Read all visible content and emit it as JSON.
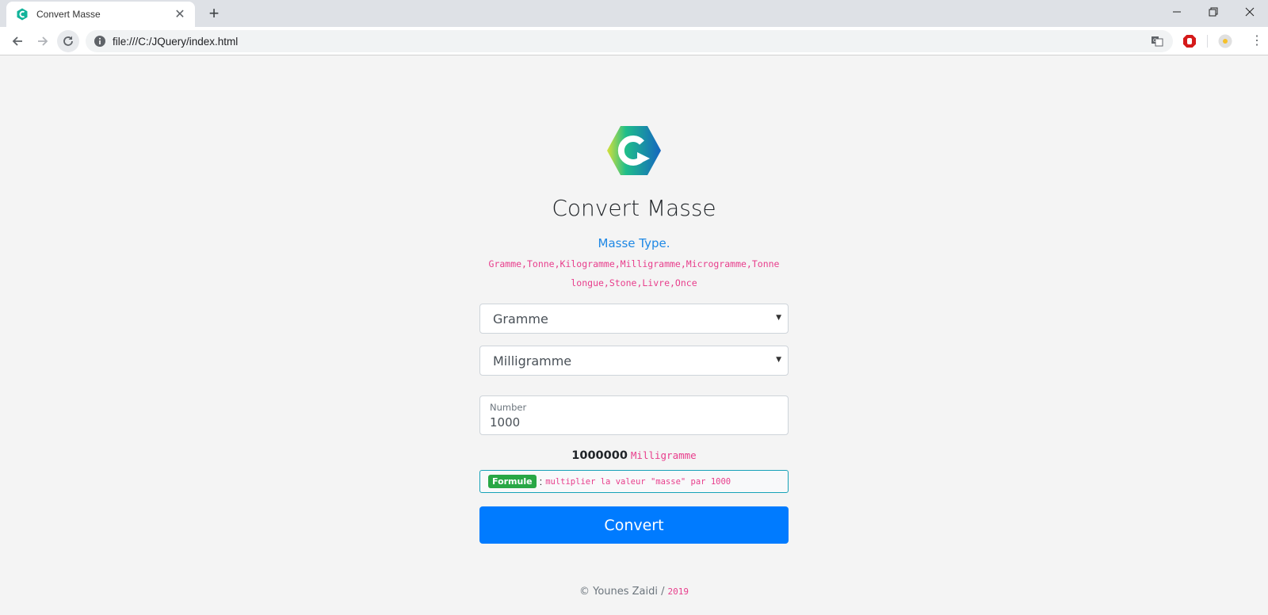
{
  "browser": {
    "tab_title": "Convert Masse",
    "new_tab_symbol": "+",
    "address": "file:///C:/JQuery/index.html"
  },
  "page": {
    "title": "Convert Masse",
    "types_heading": "Masse Type.",
    "types_list": "Gramme,Tonne,Kilogramme,Milligramme,Microgramme,Tonne longue,Stone,Livre,Once",
    "from_unit": {
      "selected": "Gramme"
    },
    "to_unit": {
      "selected": "Milligramme"
    },
    "number_field": {
      "label": "Number",
      "value": "1000"
    },
    "result": {
      "value": "1000000",
      "unit": "Milligramme"
    },
    "formula": {
      "badge": "Formule",
      "separator": ":",
      "text": "multiplier la valeur \"masse\" par 1000"
    },
    "convert_button": "Convert",
    "footer": {
      "author": "© Younes Zaidi /",
      "year": "2019"
    }
  },
  "colors": {
    "primary": "#007bff",
    "accent_pink": "#e83e8c",
    "success": "#28a745",
    "info": "#17a2b8",
    "heading_blue": "#1e88e5"
  }
}
